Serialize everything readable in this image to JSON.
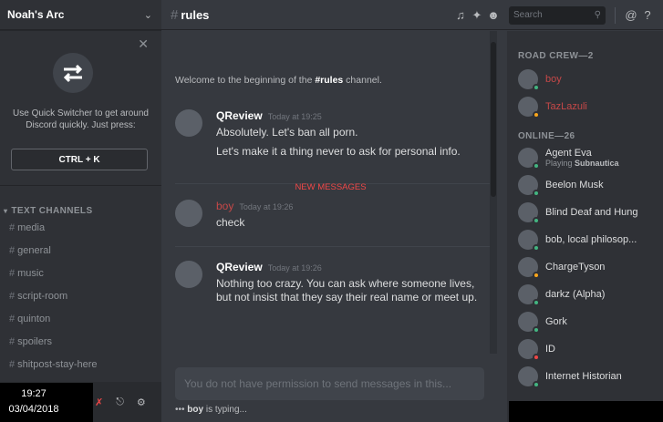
{
  "server": {
    "name": "Noah's Arc"
  },
  "quick_switcher": {
    "text": "Use Quick Switcher to get around Discord quickly. Just press:",
    "key": "CTRL + K"
  },
  "channels": {
    "category": "TEXT CHANNELS",
    "items": [
      "media",
      "general",
      "music",
      "script-room",
      "quinton",
      "spoilers",
      "shitpost-stay-here"
    ]
  },
  "clock": {
    "time": "19:27",
    "date": "03/04/2018"
  },
  "header": {
    "channel": "rules",
    "search_placeholder": "Search"
  },
  "messages": {
    "welcome_prefix": "Welcome to the beginning of the ",
    "welcome_channel": "#rules",
    "welcome_suffix": " channel.",
    "new_messages": "NEW MESSAGES",
    "groups": [
      {
        "user": "QReview",
        "time": "Today at 19:25",
        "lines": [
          "Absolutely. Let's ban all porn.",
          "Let's make it a thing never to ask for personal info."
        ]
      },
      {
        "user": "boy",
        "time": "Today at 19:26",
        "lines": [
          "check"
        ]
      },
      {
        "user": "QReview",
        "time": "Today at 19:26",
        "lines": [
          "Nothing too crazy. You can ask where someone lives, but not insist that they say their real name or meet up."
        ]
      }
    ]
  },
  "composer": {
    "placeholder": "You do not have permission to send messages in this..."
  },
  "typing": {
    "user": "boy",
    "suffix": " is typing..."
  },
  "members": {
    "road_crew_label": "ROAD CREW—2",
    "road_crew": [
      {
        "name": "boy",
        "status": "online"
      },
      {
        "name": "TazLazuli",
        "status": "idle"
      }
    ],
    "online_label": "ONLINE—26",
    "online": [
      {
        "name": "Agent Eva",
        "sub_prefix": "Playing ",
        "sub_game": "Subnautica",
        "status": "online"
      },
      {
        "name": "Beelon Musk",
        "status": "online"
      },
      {
        "name": "Blind Deaf and Hung",
        "status": "online"
      },
      {
        "name": "bob, local philosop...",
        "status": "online"
      },
      {
        "name": "ChargeTyson",
        "status": "idle"
      },
      {
        "name": "darkz (Alpha)",
        "status": "online"
      },
      {
        "name": "Gork",
        "status": "online"
      },
      {
        "name": "ID",
        "status": "dnd"
      },
      {
        "name": "Internet Historian",
        "status": "online"
      }
    ]
  },
  "colors": {
    "accent": "#f04747",
    "online": "#43b581",
    "idle": "#faa61a",
    "dnd": "#f04747"
  }
}
